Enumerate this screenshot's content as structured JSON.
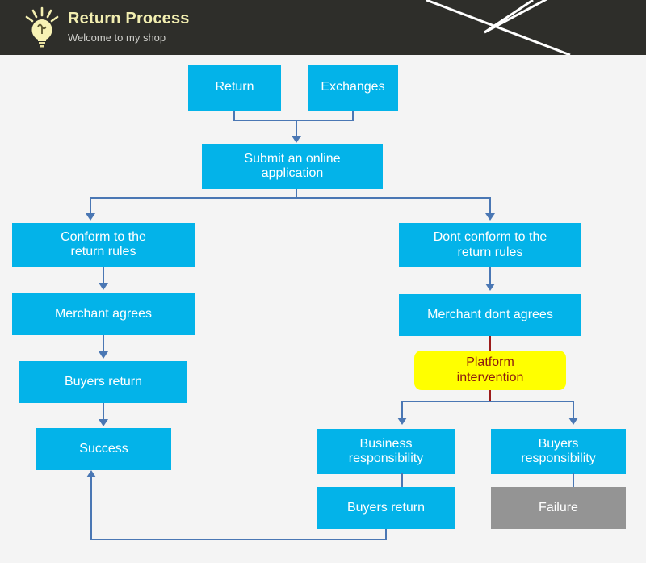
{
  "header": {
    "title": "Return Process",
    "subtitle": "Welcome to my shop",
    "logo_icon": "lightbulb-icon",
    "background_color": "#2e2e2a",
    "title_color": "#f2eeb0",
    "subtitle_color": "#cfcfcb"
  },
  "colors": {
    "canvas": "#f4f4f4",
    "node_blue": "#03b3e9",
    "node_gray": "#949494",
    "node_yellow": "#ffff00",
    "yellow_text": "#8b1a10",
    "connector": "#4a77b4",
    "connector_red": "#9b1b1b"
  },
  "diagram": {
    "type": "flowchart",
    "title": "Return Process",
    "nodes": [
      {
        "id": "return",
        "label": "Return",
        "style": "blue"
      },
      {
        "id": "exchanges",
        "label": "Exchanges",
        "style": "blue"
      },
      {
        "id": "submit",
        "label": "Submit an online application",
        "style": "blue"
      },
      {
        "id": "conform",
        "label": "Conform to the return rules",
        "style": "blue"
      },
      {
        "id": "dont-conform",
        "label": "Dont conform to the return rules",
        "style": "blue"
      },
      {
        "id": "merchant-agrees",
        "label": "Merchant agrees",
        "style": "blue"
      },
      {
        "id": "merchant-dont-agrees",
        "label": "Merchant dont agrees",
        "style": "blue"
      },
      {
        "id": "buyers-return-left",
        "label": "Buyers return",
        "style": "blue"
      },
      {
        "id": "platform",
        "label": "Platform intervention",
        "style": "yellow"
      },
      {
        "id": "success",
        "label": "Success",
        "style": "blue"
      },
      {
        "id": "business-resp",
        "label": "Business responsibility",
        "style": "blue"
      },
      {
        "id": "buyers-resp",
        "label": "Buyers responsibility",
        "style": "blue"
      },
      {
        "id": "buyers-return-right",
        "label": "Buyers return",
        "style": "blue"
      },
      {
        "id": "failure",
        "label": "Failure",
        "style": "gray"
      }
    ],
    "edges": [
      {
        "from": "return",
        "to": "submit"
      },
      {
        "from": "exchanges",
        "to": "submit"
      },
      {
        "from": "submit",
        "to": "conform"
      },
      {
        "from": "submit",
        "to": "dont-conform"
      },
      {
        "from": "conform",
        "to": "merchant-agrees"
      },
      {
        "from": "merchant-agrees",
        "to": "buyers-return-left"
      },
      {
        "from": "buyers-return-left",
        "to": "success"
      },
      {
        "from": "dont-conform",
        "to": "merchant-dont-agrees"
      },
      {
        "from": "merchant-dont-agrees",
        "to": "platform"
      },
      {
        "from": "platform",
        "to": "business-resp"
      },
      {
        "from": "platform",
        "to": "buyers-resp"
      },
      {
        "from": "business-resp",
        "to": "buyers-return-right"
      },
      {
        "from": "buyers-resp",
        "to": "failure"
      },
      {
        "from": "buyers-return-right",
        "to": "success"
      }
    ]
  },
  "labels": {
    "return": "Return",
    "exchanges": "Exchanges",
    "submit_line1": "Submit an online",
    "submit_line2": "application",
    "conform_line1": "Conform to the",
    "conform_line2": "return rules",
    "dont_conform_line1": "Dont conform to the",
    "dont_conform_line2": "return rules",
    "merchant_agrees": "Merchant agrees",
    "merchant_dont_agrees": "Merchant dont agrees",
    "buyers_return_left": "Buyers return",
    "platform_line1": "Platform",
    "platform_line2": "intervention",
    "success": "Success",
    "business_resp_line1": "Business",
    "business_resp_line2": "responsibility",
    "buyers_resp_line1": "Buyers",
    "buyers_resp_line2": "responsibility",
    "buyers_return_right": "Buyers return",
    "failure": "Failure"
  }
}
